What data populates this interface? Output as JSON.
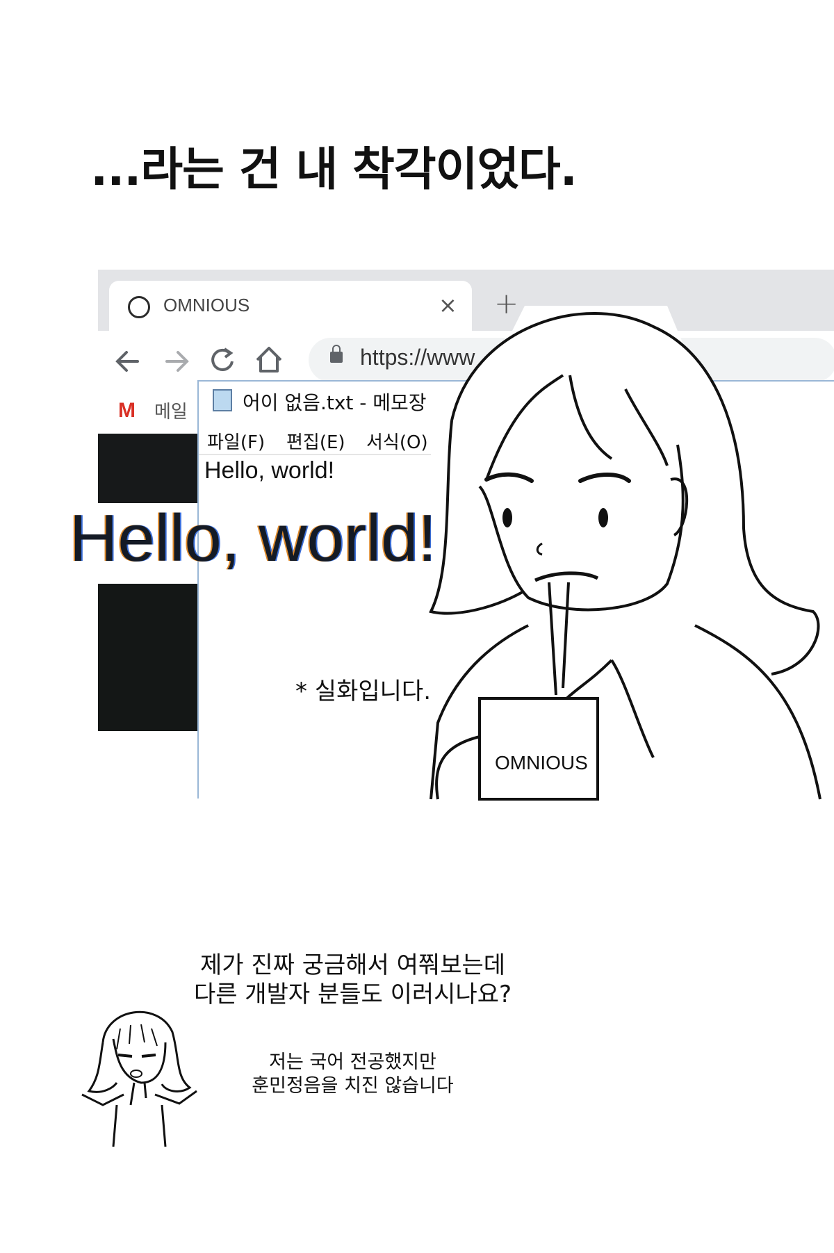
{
  "headline": "...라는 건 내 착각이었다.",
  "browser": {
    "tab_title": "OMNIOUS",
    "tab_close": "×",
    "new_tab": "+",
    "url": "https://www",
    "bookmark_icon": "M",
    "bookmark_label": "메일",
    "icons": [
      "back-arrow-icon",
      "forward-arrow-icon",
      "reload-icon",
      "home-icon",
      "lock-icon"
    ]
  },
  "notepad": {
    "title": "어이 없음.txt - 메모장",
    "menu": [
      "파일(F)",
      "편집(E)",
      "서식(O)"
    ],
    "content": "Hello, world!"
  },
  "zoomed_text": "Hello, world!",
  "note": "* 실화입니다.",
  "mug_label": "OMNIOUS",
  "question": {
    "line1": "제가 진짜 궁금해서 여쭤보는데",
    "line2": "다른 개발자 분들도 이러시나요?"
  },
  "aside": {
    "line1": "저는 국어 전공했지만",
    "line2": "훈민정음을 치진 않습니다"
  }
}
